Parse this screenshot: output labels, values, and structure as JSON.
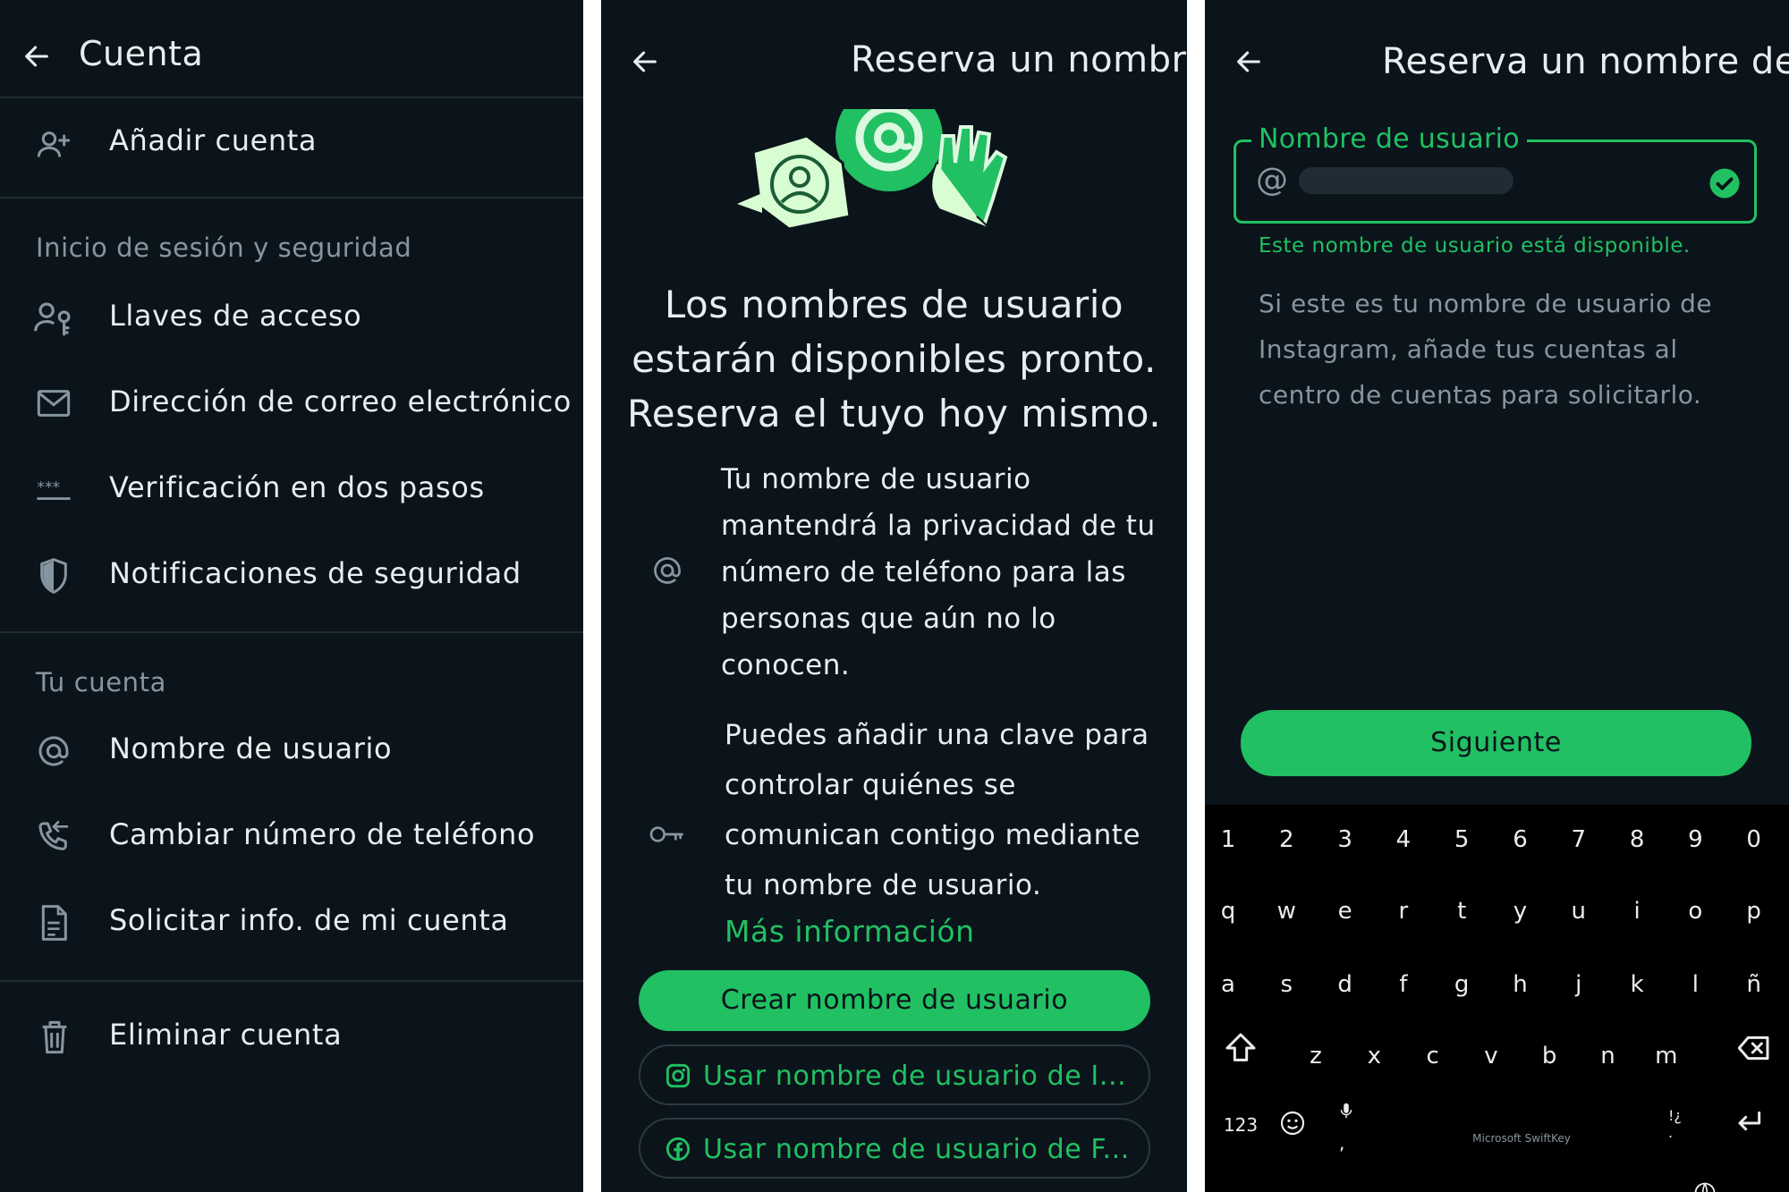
{
  "colors": {
    "background": "#0b141a",
    "accent": "#21c063",
    "text": "#e9edef",
    "muted": "#8696a0",
    "divider": "#1f2c33"
  },
  "account_screen": {
    "title": "Cuenta",
    "icons": {
      "back": "arrow-left-icon"
    },
    "items_top": [
      {
        "label": "Añadir cuenta",
        "icon": "person-add-icon"
      }
    ],
    "sections": [
      {
        "title": "Inicio de sesión y seguridad",
        "items": [
          {
            "label": "Llaves de acceso",
            "icon": "passkey-icon"
          },
          {
            "label": "Dirección de correo electrónico",
            "icon": "mail-icon"
          },
          {
            "label": "Verificación en dos pasos",
            "icon": "pin-dots-icon"
          },
          {
            "label": "Notificaciones de seguridad",
            "icon": "shield-icon"
          }
        ]
      },
      {
        "title": "Tu cuenta",
        "items": [
          {
            "label": "Nombre de usuario",
            "icon": "at-icon"
          },
          {
            "label": "Cambiar número de teléfono",
            "icon": "phone-change-icon"
          },
          {
            "label": "Solicitar info. de mi cuenta",
            "icon": "document-icon"
          }
        ]
      }
    ],
    "items_bottom": [
      {
        "label": "Eliminar cuenta",
        "icon": "trash-icon"
      }
    ]
  },
  "reserve_intro": {
    "title": "Reserva un nombre",
    "illustration": "username-illustration",
    "headline": [
      "Los nombres de usuario",
      "estarán disponibles pronto.",
      "Reserva el tuyo hoy mismo."
    ],
    "features": [
      {
        "icon": "at-icon",
        "lines": [
          "Tu nombre de usuario",
          "mantendrá la privacidad de tu",
          "número de teléfono para las",
          "personas que aún no lo",
          "conocen."
        ]
      },
      {
        "icon": "key-icon",
        "lines": [
          "Puedes añadir una clave para",
          "controlar quiénes se",
          "comunican contigo mediante",
          "tu nombre de usuario."
        ]
      }
    ],
    "more_info": "Más información",
    "primary_button": "Crear nombre de usuario",
    "secondary_buttons": [
      {
        "label": "Usar nombre de usuario de I...",
        "icon": "instagram-icon"
      },
      {
        "label": "Usar nombre de usuario de F...",
        "icon": "facebook-icon"
      }
    ]
  },
  "reserve_form": {
    "title": "Reserva un nombre de",
    "field": {
      "label": "Nombre de usuario",
      "prefix": "@",
      "value_redacted": true,
      "status_icon": "check-circle-icon"
    },
    "helper": "Este nombre de usuario está disponible.",
    "description": [
      "Si este es tu nombre de usuario de",
      "Instagram, añade tus cuentas al",
      "centro de cuentas para solicitarlo."
    ],
    "next_button": "Siguiente"
  },
  "keyboard": {
    "brand": "Microsoft SwiftKey",
    "rows": [
      [
        "1",
        "2",
        "3",
        "4",
        "5",
        "6",
        "7",
        "8",
        "9",
        "0"
      ],
      [
        "q",
        "w",
        "e",
        "r",
        "t",
        "y",
        "u",
        "i",
        "o",
        "p"
      ],
      [
        "a",
        "s",
        "d",
        "f",
        "g",
        "h",
        "j",
        "k",
        "l",
        "ñ"
      ],
      [
        "z",
        "x",
        "c",
        "v",
        "b",
        "n",
        "m"
      ]
    ],
    "numbers_key": "123",
    "icons": {
      "shift": "shift-icon",
      "backspace": "backspace-icon",
      "emoji": "emoji-icon",
      "mic": "mic-icon",
      "enter": "enter-icon",
      "globe": "globe-icon"
    }
  }
}
